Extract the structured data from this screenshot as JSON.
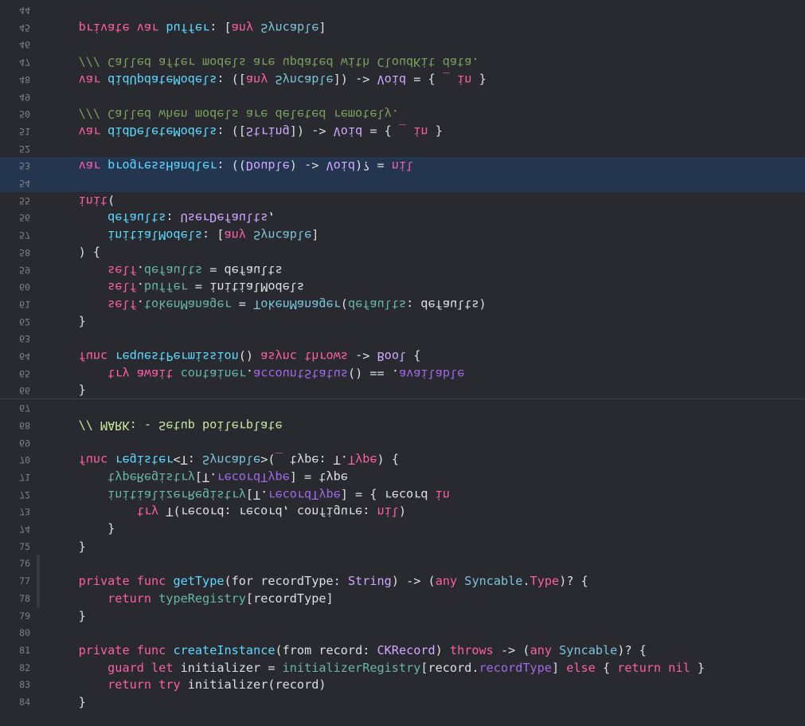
{
  "editor": {
    "lines": [
      {
        "n": "44",
        "flipped": true,
        "tokens": []
      },
      {
        "n": "45",
        "flipped": true,
        "tokens": [
          {
            "t": "    "
          },
          {
            "t": "private",
            "c": "kw"
          },
          {
            "t": " "
          },
          {
            "t": "var",
            "c": "kw"
          },
          {
            "t": " "
          },
          {
            "t": "buffer",
            "c": "cl"
          },
          {
            "t": ": ["
          },
          {
            "t": "any",
            "c": "kw"
          },
          {
            "t": " "
          },
          {
            "t": "Syncable",
            "c": "tn"
          },
          {
            "t": "]"
          }
        ]
      },
      {
        "n": "46",
        "flipped": true,
        "tokens": []
      },
      {
        "n": "47",
        "flipped": true,
        "tokens": [
          {
            "t": "    "
          },
          {
            "t": "/// Called after models are updated with CloudKit data.",
            "c": "doc"
          }
        ]
      },
      {
        "n": "48",
        "flipped": true,
        "tokens": [
          {
            "t": "    "
          },
          {
            "t": "var",
            "c": "kw"
          },
          {
            "t": " "
          },
          {
            "t": "didUpdateModels",
            "c": "cl"
          },
          {
            "t": ": (["
          },
          {
            "t": "any",
            "c": "kw"
          },
          {
            "t": " "
          },
          {
            "t": "Syncable",
            "c": "tn"
          },
          {
            "t": "]) -> "
          },
          {
            "t": "Void",
            "c": "ty"
          },
          {
            "t": " = { "
          },
          {
            "t": "_",
            "c": "kw"
          },
          {
            "t": " "
          },
          {
            "t": "in",
            "c": "kw"
          },
          {
            "t": " }"
          }
        ]
      },
      {
        "n": "49",
        "flipped": true,
        "tokens": []
      },
      {
        "n": "50",
        "flipped": true,
        "tokens": [
          {
            "t": "    "
          },
          {
            "t": "/// Called when models are deleted remotely.",
            "c": "doc"
          }
        ]
      },
      {
        "n": "51",
        "flipped": true,
        "tokens": [
          {
            "t": "    "
          },
          {
            "t": "var",
            "c": "kw"
          },
          {
            "t": " "
          },
          {
            "t": "didDeleteModels",
            "c": "cl"
          },
          {
            "t": ": (["
          },
          {
            "t": "String",
            "c": "ty"
          },
          {
            "t": "]) -> "
          },
          {
            "t": "Void",
            "c": "ty"
          },
          {
            "t": " = { "
          },
          {
            "t": "_",
            "c": "kw"
          },
          {
            "t": " "
          },
          {
            "t": "in",
            "c": "kw"
          },
          {
            "t": " }"
          }
        ]
      },
      {
        "n": "52",
        "flipped": true,
        "tokens": []
      },
      {
        "n": "53",
        "flipped": true,
        "hl": true,
        "tokens": [
          {
            "t": "    "
          },
          {
            "t": "var",
            "c": "kw"
          },
          {
            "t": " "
          },
          {
            "t": "progressHandler",
            "c": "cl"
          },
          {
            "t": ": (("
          },
          {
            "t": "Double",
            "c": "ty"
          },
          {
            "t": ") -> "
          },
          {
            "t": "Void",
            "c": "ty"
          },
          {
            "t": ")? = "
          },
          {
            "t": "nil",
            "c": "kw"
          }
        ]
      },
      {
        "n": "54",
        "flipped": true,
        "hl": true,
        "tokens": []
      },
      {
        "n": "55",
        "flipped": true,
        "tokens": [
          {
            "t": "    "
          },
          {
            "t": "init",
            "c": "kw"
          },
          {
            "t": "("
          }
        ]
      },
      {
        "n": "56",
        "flipped": true,
        "tokens": [
          {
            "t": "        "
          },
          {
            "t": "defaults",
            "c": "cl"
          },
          {
            "t": ": "
          },
          {
            "t": "UserDefaults",
            "c": "ty"
          },
          {
            "t": ","
          }
        ]
      },
      {
        "n": "57",
        "flipped": true,
        "tokens": [
          {
            "t": "        "
          },
          {
            "t": "initialModels",
            "c": "cl"
          },
          {
            "t": ": ["
          },
          {
            "t": "any",
            "c": "kw"
          },
          {
            "t": " "
          },
          {
            "t": "Syncable",
            "c": "tn"
          },
          {
            "t": "]"
          }
        ]
      },
      {
        "n": "58",
        "flipped": true,
        "tokens": [
          {
            "t": "    ) {"
          }
        ]
      },
      {
        "n": "59",
        "flipped": true,
        "tokens": [
          {
            "t": "        "
          },
          {
            "t": "self",
            "c": "kw"
          },
          {
            "t": "."
          },
          {
            "t": "defaults",
            "c": "pr"
          },
          {
            "t": " = defaults"
          }
        ]
      },
      {
        "n": "60",
        "flipped": true,
        "tokens": [
          {
            "t": "        "
          },
          {
            "t": "self",
            "c": "kw"
          },
          {
            "t": "."
          },
          {
            "t": "buffer",
            "c": "pr"
          },
          {
            "t": " = initialModels"
          }
        ]
      },
      {
        "n": "61",
        "flipped": true,
        "tokens": [
          {
            "t": "        "
          },
          {
            "t": "self",
            "c": "kw"
          },
          {
            "t": "."
          },
          {
            "t": "tokenManager",
            "c": "pr"
          },
          {
            "t": " = "
          },
          {
            "t": "TokenManager",
            "c": "tn"
          },
          {
            "t": "("
          },
          {
            "t": "defaults",
            "c": "pr"
          },
          {
            "t": ": defaults)"
          }
        ]
      },
      {
        "n": "62",
        "flipped": true,
        "tokens": [
          {
            "t": "    }"
          }
        ]
      },
      {
        "n": "63",
        "flipped": true,
        "tokens": []
      },
      {
        "n": "64",
        "flipped": true,
        "tokens": [
          {
            "t": "    "
          },
          {
            "t": "func",
            "c": "kw"
          },
          {
            "t": " "
          },
          {
            "t": "requestPermission",
            "c": "cl"
          },
          {
            "t": "() "
          },
          {
            "t": "async",
            "c": "kw"
          },
          {
            "t": " "
          },
          {
            "t": "throws",
            "c": "kw"
          },
          {
            "t": " -> "
          },
          {
            "t": "Bool",
            "c": "ty"
          },
          {
            "t": " {"
          }
        ]
      },
      {
        "n": "65",
        "flipped": true,
        "tokens": [
          {
            "t": "        "
          },
          {
            "t": "try",
            "c": "kw"
          },
          {
            "t": " "
          },
          {
            "t": "await",
            "c": "kw"
          },
          {
            "t": " "
          },
          {
            "t": "container",
            "c": "pr"
          },
          {
            "t": "."
          },
          {
            "t": "accountStatus",
            "c": "vl"
          },
          {
            "t": "() == ."
          },
          {
            "t": "available",
            "c": "vl"
          }
        ]
      },
      {
        "n": "66",
        "flipped": true,
        "tokens": [
          {
            "t": "    }"
          }
        ]
      },
      {
        "n": "67",
        "flipped": true,
        "sep": true,
        "tokens": []
      },
      {
        "n": "68",
        "flipped": true,
        "tokens": [
          {
            "t": "    "
          },
          {
            "t": "// MARK: - Setup boilerplate",
            "c": "mk"
          }
        ]
      },
      {
        "n": "69",
        "flipped": true,
        "tokens": []
      },
      {
        "n": "70",
        "flipped": true,
        "tokens": [
          {
            "t": "    "
          },
          {
            "t": "func",
            "c": "kw"
          },
          {
            "t": " "
          },
          {
            "t": "register",
            "c": "cl"
          },
          {
            "t": "<T: "
          },
          {
            "t": "Syncable",
            "c": "tn"
          },
          {
            "t": ">("
          },
          {
            "t": "_",
            "c": "kw"
          },
          {
            "t": " type: T."
          },
          {
            "t": "Type",
            "c": "kw"
          },
          {
            "t": ") {"
          }
        ]
      },
      {
        "n": "71",
        "flipped": true,
        "tokens": [
          {
            "t": "        "
          },
          {
            "t": "typeRegistry",
            "c": "pr"
          },
          {
            "t": "[T."
          },
          {
            "t": "recordType",
            "c": "vl"
          },
          {
            "t": "] = type"
          }
        ]
      },
      {
        "n": "72",
        "flipped": true,
        "tokens": [
          {
            "t": "        "
          },
          {
            "t": "initializerRegistry",
            "c": "pr"
          },
          {
            "t": "[T."
          },
          {
            "t": "recordType",
            "c": "vl"
          },
          {
            "t": "] = { record "
          },
          {
            "t": "in",
            "c": "kw"
          }
        ]
      },
      {
        "n": "73",
        "flipped": true,
        "tokens": [
          {
            "t": "            "
          },
          {
            "t": "try",
            "c": "kw"
          },
          {
            "t": " T(record: record, configure: "
          },
          {
            "t": "nil",
            "c": "kw"
          },
          {
            "t": ")"
          }
        ]
      },
      {
        "n": "74",
        "flipped": true,
        "tokens": [
          {
            "t": "        }"
          }
        ]
      },
      {
        "n": "75",
        "flipped": false,
        "tokens": [
          {
            "t": "    }"
          }
        ]
      },
      {
        "n": "76",
        "flipped": false,
        "tokens": []
      },
      {
        "n": "77",
        "flipped": false,
        "tokens": [
          {
            "t": "    "
          },
          {
            "t": "private",
            "c": "kw"
          },
          {
            "t": " "
          },
          {
            "t": "func",
            "c": "kw"
          },
          {
            "t": " "
          },
          {
            "t": "getType",
            "c": "cl"
          },
          {
            "t": "(for recordType: "
          },
          {
            "t": "String",
            "c": "ty"
          },
          {
            "t": ") -> ("
          },
          {
            "t": "any",
            "c": "kw"
          },
          {
            "t": " "
          },
          {
            "t": "Syncable",
            "c": "tn"
          },
          {
            "t": "."
          },
          {
            "t": "Type",
            "c": "kw"
          },
          {
            "t": ")? {"
          }
        ]
      },
      {
        "n": "78",
        "flipped": false,
        "tokens": [
          {
            "t": "        "
          },
          {
            "t": "return",
            "c": "kw"
          },
          {
            "t": " "
          },
          {
            "t": "typeRegistry",
            "c": "pr"
          },
          {
            "t": "[recordType]"
          }
        ]
      },
      {
        "n": "79",
        "flipped": false,
        "tokens": [
          {
            "t": "    }"
          }
        ]
      },
      {
        "n": "80",
        "flipped": false,
        "tokens": []
      },
      {
        "n": "81",
        "flipped": false,
        "tokens": [
          {
            "t": "    "
          },
          {
            "t": "private",
            "c": "kw"
          },
          {
            "t": " "
          },
          {
            "t": "func",
            "c": "kw"
          },
          {
            "t": " "
          },
          {
            "t": "createInstance",
            "c": "cl"
          },
          {
            "t": "(from record: "
          },
          {
            "t": "CKRecord",
            "c": "ty"
          },
          {
            "t": ") "
          },
          {
            "t": "throws",
            "c": "kw"
          },
          {
            "t": " -> ("
          },
          {
            "t": "any",
            "c": "kw"
          },
          {
            "t": " "
          },
          {
            "t": "Syncable",
            "c": "tn"
          },
          {
            "t": ")? {"
          }
        ]
      },
      {
        "n": "82",
        "flipped": false,
        "tokens": [
          {
            "t": "        "
          },
          {
            "t": "guard",
            "c": "kw"
          },
          {
            "t": " "
          },
          {
            "t": "let",
            "c": "kw"
          },
          {
            "t": " initializer = "
          },
          {
            "t": "initializerRegistry",
            "c": "pr"
          },
          {
            "t": "[record."
          },
          {
            "t": "recordType",
            "c": "vl"
          },
          {
            "t": "] "
          },
          {
            "t": "else",
            "c": "kw"
          },
          {
            "t": " { "
          },
          {
            "t": "return",
            "c": "kw"
          },
          {
            "t": " "
          },
          {
            "t": "nil",
            "c": "kw"
          },
          {
            "t": " }"
          }
        ]
      },
      {
        "n": "83",
        "flipped": false,
        "tokens": [
          {
            "t": "        "
          },
          {
            "t": "return",
            "c": "kw"
          },
          {
            "t": " "
          },
          {
            "t": "try",
            "c": "kw"
          },
          {
            "t": " initializer(record)"
          }
        ]
      },
      {
        "n": "84",
        "flipped": false,
        "tokens": [
          {
            "t": "    }"
          }
        ]
      }
    ]
  }
}
